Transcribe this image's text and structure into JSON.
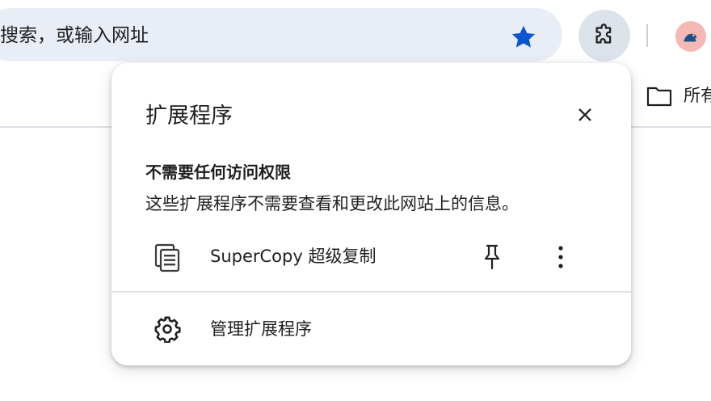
{
  "omnibox": {
    "placeholder": "搜索，或输入网址",
    "bookmark_star_icon": "star-filled-icon"
  },
  "toolbar": {
    "extensions_icon": "puzzle-icon",
    "profile_icon": "avatar"
  },
  "bookmarks_bar": {
    "folder_label": "所有"
  },
  "extensions_popup": {
    "title": "扩展程序",
    "section_heading": "不需要任何访问权限",
    "section_description": "这些扩展程序不需要查看和更改此网站上的信息。",
    "extensions": [
      {
        "name": "SuperCopy 超级复制",
        "icon": "supercopy-icon",
        "pinned": false
      }
    ],
    "manage_label": "管理扩展程序"
  },
  "colors": {
    "accent": "#0b57d0",
    "omnibox_bg": "#e9eef6",
    "extension_button_bg": "#dde3ea",
    "avatar_bg": "#f4b9b4"
  }
}
